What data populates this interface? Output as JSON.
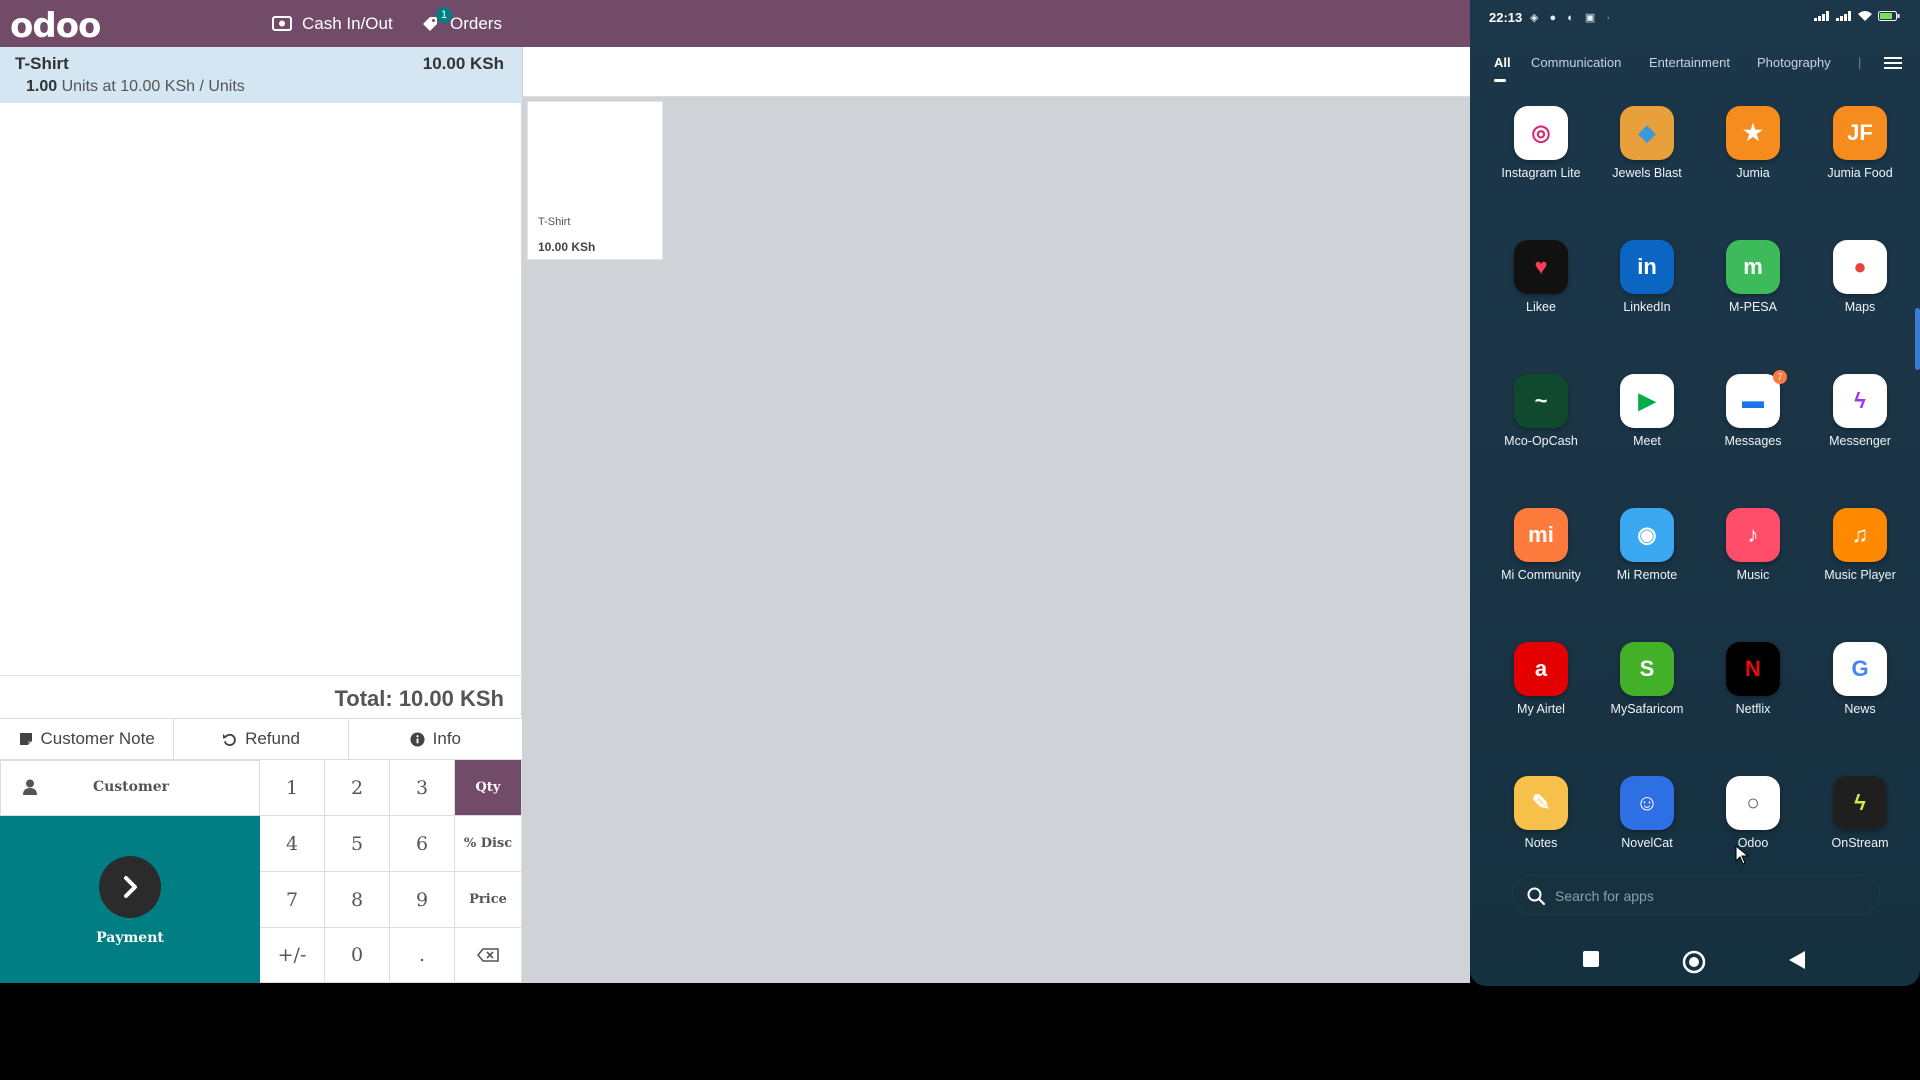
{
  "pos": {
    "logo": "odoo",
    "topbar": {
      "cash_label": "Cash In/Out",
      "orders_label": "Orders",
      "orders_badge": "1"
    },
    "orderline": {
      "name": "T-Shirt",
      "price": "10.00 KSh",
      "qty": "1.00",
      "detail": "Units at 10.00 KSh / Units"
    },
    "total": "Total: 10.00 KSh",
    "controls": {
      "customer_note": "Customer Note",
      "refund": "Refund",
      "info": "Info"
    },
    "customer_label": "Customer",
    "payment_label": "Payment",
    "keys": [
      "1",
      "2",
      "3",
      "Qty",
      "4",
      "5",
      "6",
      "% Disc",
      "7",
      "8",
      "9",
      "Price",
      "+/-",
      "0",
      ".",
      ""
    ],
    "active_mode": "Qty",
    "product": {
      "name": "T-Shirt",
      "price": "10.00 KSh"
    },
    "colors": {
      "brand": "#714b67",
      "teal": "#017e84",
      "selected_line": "#d4e6f1"
    }
  },
  "phone": {
    "time": "22:13",
    "tabs": [
      "All",
      "Communication",
      "Entertainment",
      "Photography"
    ],
    "active_tab": "All",
    "apps": [
      {
        "label": "Instagram Lite",
        "icon": "instagram-icon",
        "color": "#ffffff",
        "glyph": "◎",
        "fg": "#d62976"
      },
      {
        "label": "Jewels Blast",
        "icon": "jewels-blast-icon",
        "color": "#e8a03a",
        "glyph": "◆",
        "fg": "#3a9ad9"
      },
      {
        "label": "Jumia",
        "icon": "jumia-icon",
        "color": "#f68b1e",
        "glyph": "★",
        "fg": "#ffffff"
      },
      {
        "label": "Jumia Food",
        "icon": "jumia-food-icon",
        "color": "#f68b1e",
        "glyph": "JF",
        "fg": "#ffffff"
      },
      {
        "label": "Likee",
        "icon": "likee-icon",
        "color": "#111111",
        "glyph": "♥",
        "fg": "#ff3b5c"
      },
      {
        "label": "LinkedIn",
        "icon": "linkedin-icon",
        "color": "#0a66c2",
        "glyph": "in",
        "fg": "#ffffff"
      },
      {
        "label": "M-PESA",
        "icon": "mpesa-icon",
        "color": "#3dbb5a",
        "glyph": "m",
        "fg": "#ffffff"
      },
      {
        "label": "Maps",
        "icon": "maps-icon",
        "color": "#ffffff",
        "glyph": "●",
        "fg": "#ea4335"
      },
      {
        "label": "Mco-OpCash",
        "icon": "mco-opcash-icon",
        "color": "#0f4a2e",
        "glyph": "~",
        "fg": "#ffffff"
      },
      {
        "label": "Meet",
        "icon": "meet-icon",
        "color": "#ffffff",
        "glyph": "▶",
        "fg": "#00ac47"
      },
      {
        "label": "Messages",
        "icon": "messages-icon",
        "color": "#ffffff",
        "glyph": "▬",
        "fg": "#1a73e8",
        "badge": "7"
      },
      {
        "label": "Messenger",
        "icon": "messenger-icon",
        "color": "#ffffff",
        "glyph": "ϟ",
        "fg": "#a033ff"
      },
      {
        "label": "Mi Community",
        "icon": "mi-community-icon",
        "color": "#ff7a3d",
        "glyph": "mi",
        "fg": "#ffffff"
      },
      {
        "label": "Mi Remote",
        "icon": "mi-remote-icon",
        "color": "#3aa8f0",
        "glyph": "◉",
        "fg": "#ffffff"
      },
      {
        "label": "Music",
        "icon": "music-icon",
        "color": "#ff4d6a",
        "glyph": "♪",
        "fg": "#ffffff"
      },
      {
        "label": "Music Player",
        "icon": "music-player-icon",
        "color": "#ff8a00",
        "glyph": "♫",
        "fg": "#ffffff"
      },
      {
        "label": "My Airtel",
        "icon": "my-airtel-icon",
        "color": "#e40000",
        "glyph": "a",
        "fg": "#ffffff"
      },
      {
        "label": "MySafaricom",
        "icon": "mysafaricom-icon",
        "color": "#43b02a",
        "glyph": "S",
        "fg": "#ffffff"
      },
      {
        "label": "Netflix",
        "icon": "netflix-icon",
        "color": "#000000",
        "glyph": "N",
        "fg": "#e50914"
      },
      {
        "label": "News",
        "icon": "news-icon",
        "color": "#ffffff",
        "glyph": "G",
        "fg": "#4285f4"
      },
      {
        "label": "Notes",
        "icon": "notes-icon",
        "color": "#f7c04a",
        "glyph": "✎",
        "fg": "#ffffff"
      },
      {
        "label": "NovelCat",
        "icon": "novelcat-icon",
        "color": "#2f6fe4",
        "glyph": "☺",
        "fg": "#ffffff"
      },
      {
        "label": "Odoo",
        "icon": "odoo-icon",
        "color": "#ffffff",
        "glyph": "○",
        "fg": "#714b67"
      },
      {
        "label": "OnStream",
        "icon": "onstream-icon",
        "color": "#1f1f1f",
        "glyph": "ϟ",
        "fg": "#c8f04a"
      }
    ],
    "search_placeholder": "Search for apps"
  }
}
